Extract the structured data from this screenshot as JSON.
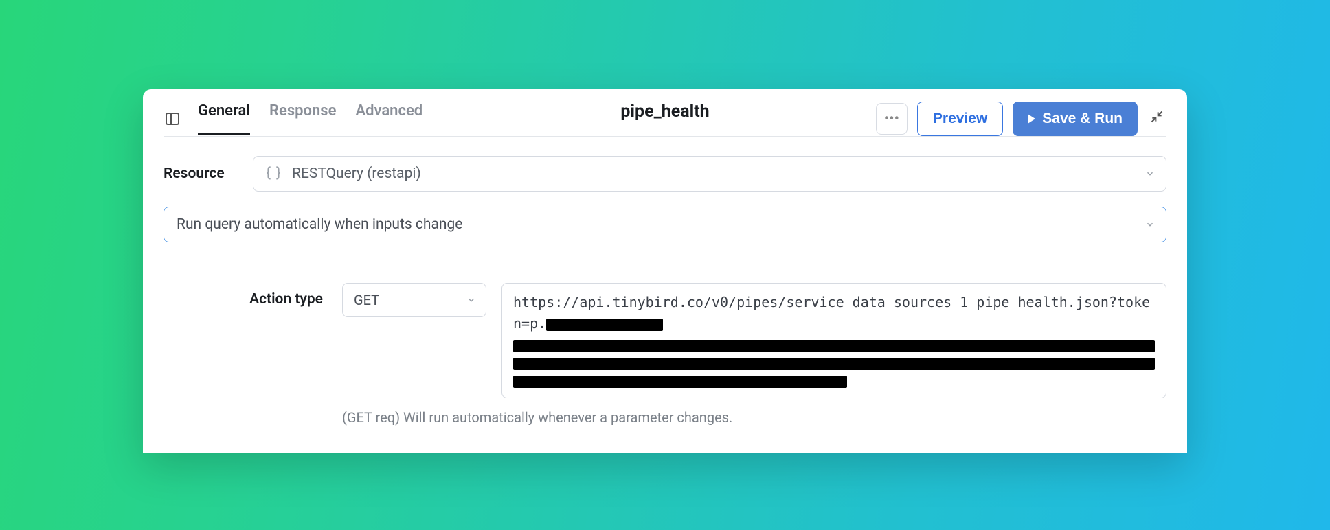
{
  "header": {
    "tabs": [
      {
        "label": "General",
        "active": true
      },
      {
        "label": "Response",
        "active": false
      },
      {
        "label": "Advanced",
        "active": false
      }
    ],
    "title": "pipe_health",
    "preview_label": "Preview",
    "save_run_label": "Save & Run"
  },
  "resource": {
    "label": "Resource",
    "value": "RESTQuery (restapi)"
  },
  "run_mode": {
    "value": "Run query automatically when inputs change"
  },
  "action": {
    "label": "Action type",
    "method": "GET",
    "url_prefix": "https://api.tinybird.co/v0/pipes/service_data_sources_1_pipe_health.json?token=p.",
    "help": "(GET req) Will run automatically whenever a parameter changes."
  }
}
